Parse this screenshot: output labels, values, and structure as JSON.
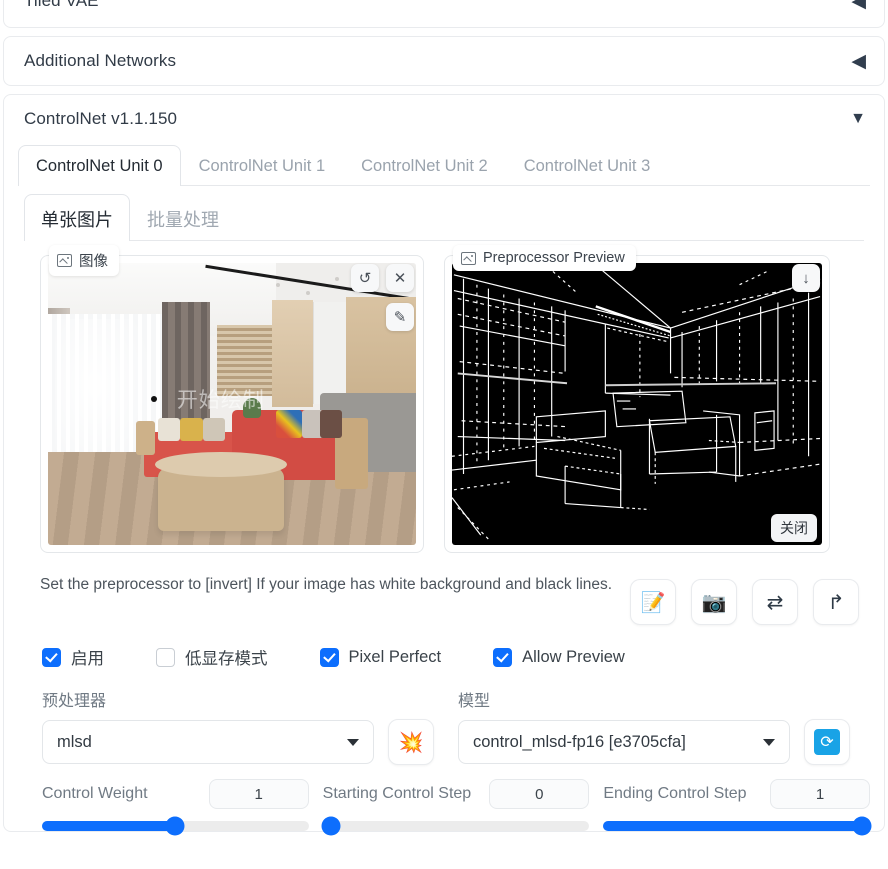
{
  "panels": {
    "tiled_vae": {
      "title": "Tiled VAE",
      "arrow": "left-triangle-icon"
    },
    "additional_networks": {
      "title": "Additional Networks",
      "arrow": "left-triangle-icon"
    },
    "controlnet": {
      "title": "ControlNet v1.1.150",
      "arrow": "down-triangle-icon"
    }
  },
  "unit_tabs": [
    {
      "label": "ControlNet Unit 0",
      "active": true
    },
    {
      "label": "ControlNet Unit 1",
      "active": false
    },
    {
      "label": "ControlNet Unit 2",
      "active": false
    },
    {
      "label": "ControlNet Unit 3",
      "active": false
    }
  ],
  "mode_tabs": [
    {
      "label": "单张图片",
      "active": true
    },
    {
      "label": "批量处理",
      "active": false
    }
  ],
  "image_card": {
    "tag": "图像",
    "watermark": "开始绘制",
    "undo_icon": "undo-icon",
    "close_icon": "close-icon",
    "pen_icon": "pen-icon"
  },
  "preview_card": {
    "tag": "Preprocessor Preview",
    "download_icon": "download-icon",
    "close_label": "关闭"
  },
  "hint": "Set the preprocessor to [invert] If your image has white background and black lines.",
  "action_buttons": [
    {
      "name": "edit-note-button",
      "glyph": "📝"
    },
    {
      "name": "camera-button",
      "glyph": "📷"
    },
    {
      "name": "swap-button",
      "glyph": "⇄"
    },
    {
      "name": "send-arrow-button",
      "glyph": "↱"
    }
  ],
  "checkboxes": [
    {
      "label": "启用",
      "checked": true
    },
    {
      "label": "低显存模式",
      "checked": false
    },
    {
      "label": "Pixel Perfect",
      "checked": true
    },
    {
      "label": "Allow Preview",
      "checked": true
    }
  ],
  "selects": {
    "preprocessor": {
      "label": "预处理器",
      "value": "mlsd",
      "action_glyph": "💥",
      "action_name": "run-preprocessor-button"
    },
    "model": {
      "label": "模型",
      "value": "control_mlsd-fp16 [e3705cfa]",
      "action_glyph": "⟳",
      "action_name": "refresh-models-button"
    }
  },
  "sliders": [
    {
      "label": "Control Weight",
      "value": "1",
      "percent": 50
    },
    {
      "label": "Starting Control Step",
      "value": "0",
      "percent": 0
    },
    {
      "label": "Ending Control Step",
      "value": "1",
      "percent": 100
    }
  ],
  "colors": {
    "accent": "#0d6efd",
    "refresh": "#19a3e6",
    "panel_border": "#e9ebee",
    "muted_text": "#9aa3ad"
  }
}
